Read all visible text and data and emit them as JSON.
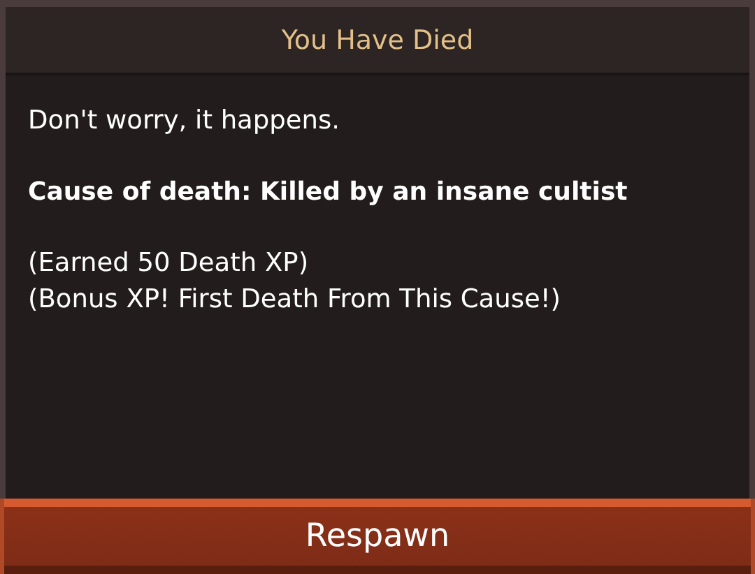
{
  "dialog": {
    "title": "You Have Died",
    "message": "Don't worry, it happens.",
    "cause": "Cause of death: Killed by an insane cultist",
    "rewards": [
      "(Earned 50 Death XP)",
      "(Bonus XP! First Death From This Cause!)"
    ],
    "button": "Respawn"
  }
}
